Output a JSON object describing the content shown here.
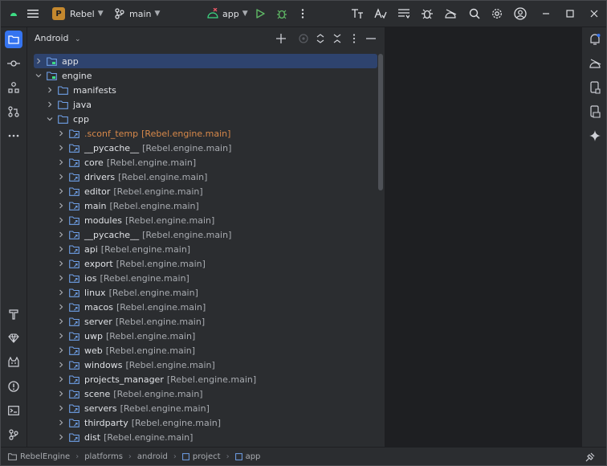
{
  "titlebar": {
    "project_badge": "P",
    "project_name": "Rebel",
    "branch": "main",
    "run_config": "app"
  },
  "panel": {
    "view_mode": "Android"
  },
  "tree": [
    {
      "name": "app",
      "module": "",
      "depth": 0,
      "expanded": false,
      "type": "module",
      "selected": true,
      "excluded": false
    },
    {
      "name": "engine",
      "module": "",
      "depth": 0,
      "expanded": true,
      "type": "module",
      "selected": false,
      "excluded": false
    },
    {
      "name": "manifests",
      "module": "",
      "depth": 1,
      "expanded": false,
      "type": "folder",
      "selected": false,
      "excluded": false
    },
    {
      "name": "java",
      "module": "",
      "depth": 1,
      "expanded": false,
      "type": "folder",
      "selected": false,
      "excluded": false
    },
    {
      "name": "cpp",
      "module": "",
      "depth": 1,
      "expanded": true,
      "type": "folder",
      "selected": false,
      "excluded": false
    },
    {
      "name": ".sconf_temp",
      "module": "[Rebel.engine.main]",
      "depth": 2,
      "expanded": false,
      "type": "link",
      "selected": false,
      "excluded": true
    },
    {
      "name": "__pycache__",
      "module": "[Rebel.engine.main]",
      "depth": 2,
      "expanded": false,
      "type": "link",
      "selected": false,
      "excluded": false
    },
    {
      "name": "core",
      "module": "[Rebel.engine.main]",
      "depth": 2,
      "expanded": false,
      "type": "link",
      "selected": false,
      "excluded": false
    },
    {
      "name": "drivers",
      "module": "[Rebel.engine.main]",
      "depth": 2,
      "expanded": false,
      "type": "link",
      "selected": false,
      "excluded": false
    },
    {
      "name": "editor",
      "module": "[Rebel.engine.main]",
      "depth": 2,
      "expanded": false,
      "type": "link",
      "selected": false,
      "excluded": false
    },
    {
      "name": "main",
      "module": "[Rebel.engine.main]",
      "depth": 2,
      "expanded": false,
      "type": "link",
      "selected": false,
      "excluded": false
    },
    {
      "name": "modules",
      "module": "[Rebel.engine.main]",
      "depth": 2,
      "expanded": false,
      "type": "link",
      "selected": false,
      "excluded": false
    },
    {
      "name": "__pycache__",
      "module": "[Rebel.engine.main]",
      "depth": 2,
      "expanded": false,
      "type": "link",
      "selected": false,
      "excluded": false
    },
    {
      "name": "api",
      "module": "[Rebel.engine.main]",
      "depth": 2,
      "expanded": false,
      "type": "link",
      "selected": false,
      "excluded": false
    },
    {
      "name": "export",
      "module": "[Rebel.engine.main]",
      "depth": 2,
      "expanded": false,
      "type": "link",
      "selected": false,
      "excluded": false
    },
    {
      "name": "ios",
      "module": "[Rebel.engine.main]",
      "depth": 2,
      "expanded": false,
      "type": "link",
      "selected": false,
      "excluded": false
    },
    {
      "name": "linux",
      "module": "[Rebel.engine.main]",
      "depth": 2,
      "expanded": false,
      "type": "link",
      "selected": false,
      "excluded": false
    },
    {
      "name": "macos",
      "module": "[Rebel.engine.main]",
      "depth": 2,
      "expanded": false,
      "type": "link",
      "selected": false,
      "excluded": false
    },
    {
      "name": "server",
      "module": "[Rebel.engine.main]",
      "depth": 2,
      "expanded": false,
      "type": "link",
      "selected": false,
      "excluded": false
    },
    {
      "name": "uwp",
      "module": "[Rebel.engine.main]",
      "depth": 2,
      "expanded": false,
      "type": "link",
      "selected": false,
      "excluded": false
    },
    {
      "name": "web",
      "module": "[Rebel.engine.main]",
      "depth": 2,
      "expanded": false,
      "type": "link",
      "selected": false,
      "excluded": false
    },
    {
      "name": "windows",
      "module": "[Rebel.engine.main]",
      "depth": 2,
      "expanded": false,
      "type": "link",
      "selected": false,
      "excluded": false
    },
    {
      "name": "projects_manager",
      "module": "[Rebel.engine.main]",
      "depth": 2,
      "expanded": false,
      "type": "link",
      "selected": false,
      "excluded": false
    },
    {
      "name": "scene",
      "module": "[Rebel.engine.main]",
      "depth": 2,
      "expanded": false,
      "type": "link",
      "selected": false,
      "excluded": false
    },
    {
      "name": "servers",
      "module": "[Rebel.engine.main]",
      "depth": 2,
      "expanded": false,
      "type": "link",
      "selected": false,
      "excluded": false
    },
    {
      "name": "thirdparty",
      "module": "[Rebel.engine.main]",
      "depth": 2,
      "expanded": false,
      "type": "link",
      "selected": false,
      "excluded": false
    },
    {
      "name": "dist",
      "module": "[Rebel.engine.main]",
      "depth": 2,
      "expanded": false,
      "type": "link",
      "selected": false,
      "excluded": false
    }
  ],
  "breadcrumb": {
    "items": [
      {
        "label": "RebelEngine",
        "icon": "folder-icon"
      },
      {
        "label": "platforms",
        "icon": ""
      },
      {
        "label": "android",
        "icon": ""
      },
      {
        "label": "project",
        "icon": "module-icon"
      },
      {
        "label": "app",
        "icon": "module-icon"
      }
    ]
  },
  "colors": {
    "accent": "#3574f0",
    "selection": "#2e436e",
    "excluded": "#d8894a",
    "panel": "#2b2d30",
    "editor": "#1e1f22"
  }
}
